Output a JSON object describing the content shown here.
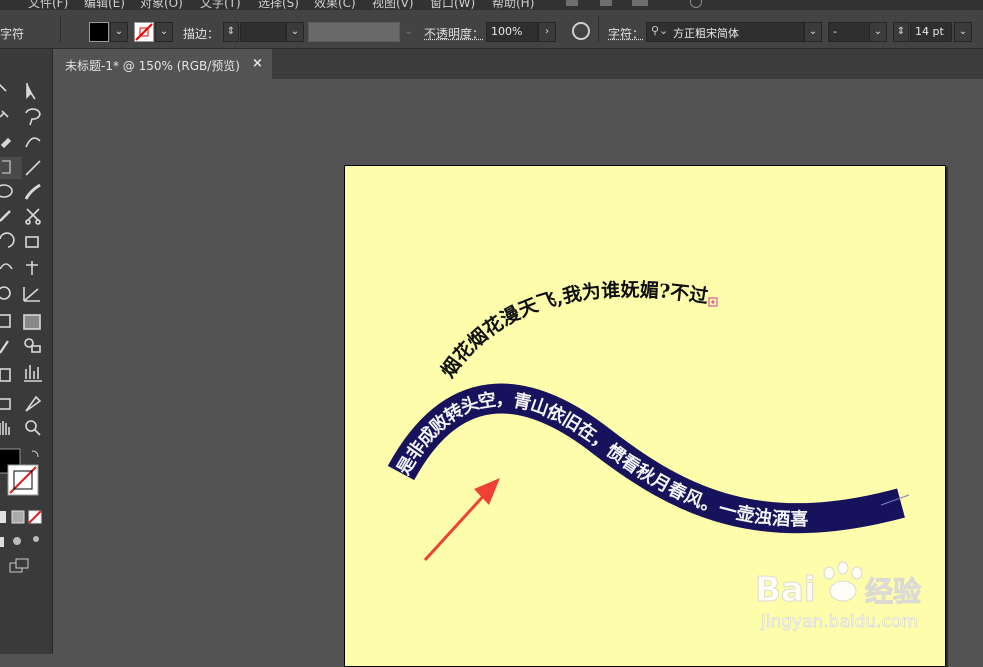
{
  "menubar": {
    "items": [
      "文件(F)",
      "编辑(E)",
      "对象(O)",
      "文字(T)",
      "选择(S)",
      "效果(C)",
      "视图(V)",
      "窗口(W)",
      "帮助(H)"
    ]
  },
  "controlbar": {
    "panel_label": "字符",
    "stroke_label": "描边：",
    "opacity_label": "不透明度：",
    "opacity_value": "100%",
    "char_label": "字符：",
    "font_family": "方正粗宋简体",
    "font_style": "-",
    "font_size": "14 pt"
  },
  "document": {
    "tab_title": "未标题-1* @ 150% (RGB/预览)",
    "close_glyph": "×"
  },
  "artwork": {
    "path_text_top": "烟花烟花漫天飞,我为谁妩媚?不过",
    "path_text_band": "是非成败转头空，青山依旧在，惯看秋月春风。一壶浊酒喜",
    "colors": {
      "artboard": "#fdfdab",
      "band": "#16125c",
      "arrow": "#ef4136",
      "text_dark": "#0f0f0f",
      "text_light": "#f4f4f4"
    }
  },
  "watermark": {
    "brand_left": "Bai",
    "brand_right": "经验",
    "url": "jingyan.baidu.com"
  },
  "icons": [
    "selection-icon",
    "direct-selection-icon",
    "magic-wand-icon",
    "lasso-icon",
    "pen-icon",
    "curvature-icon",
    "type-icon",
    "line-icon",
    "ellipse-icon",
    "paintbrush-icon",
    "pencil-icon",
    "scissors-icon",
    "rotate-icon",
    "scale-icon",
    "width-icon",
    "puppet-icon",
    "shape-builder-icon",
    "perspective-icon",
    "mesh-icon",
    "gradient-icon",
    "eyedropper-icon",
    "blend-icon",
    "symbol-sprayer-icon",
    "column-graph-icon",
    "artboard-icon",
    "slice-icon",
    "hand-icon",
    "zoom-icon"
  ]
}
